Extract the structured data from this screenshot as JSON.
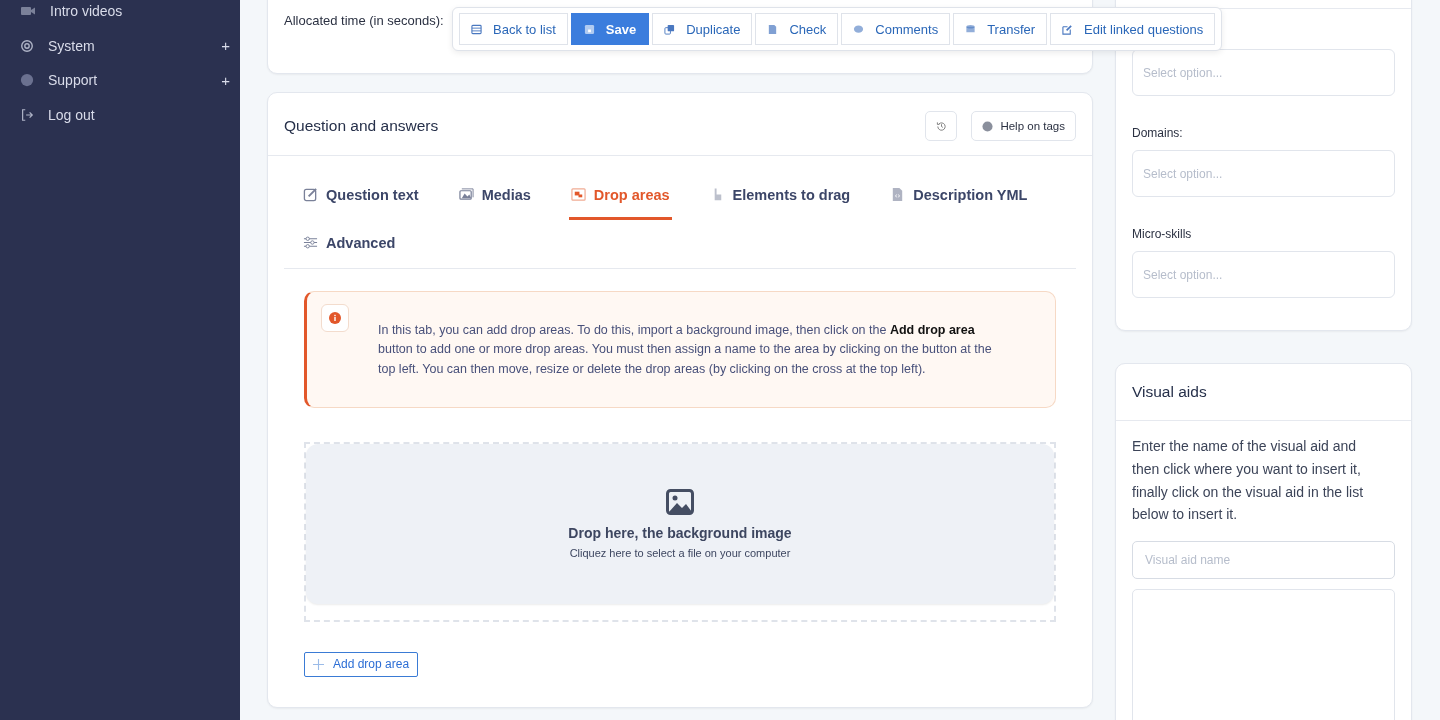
{
  "sidebar": {
    "items": [
      {
        "label": "Intro videos",
        "expandable": false
      },
      {
        "label": "System",
        "expandable": true
      },
      {
        "label": "Support",
        "expandable": true
      },
      {
        "label": "Log out",
        "expandable": false
      }
    ],
    "expand_symbol": "+"
  },
  "top_card": {
    "field_label": "Allocated time (in seconds):"
  },
  "toolbar": [
    {
      "label": "Back to list",
      "primary": false
    },
    {
      "label": "Save",
      "primary": true
    },
    {
      "label": "Duplicate",
      "primary": false
    },
    {
      "label": "Check",
      "primary": false
    },
    {
      "label": "Comments",
      "primary": false
    },
    {
      "label": "Transfer",
      "primary": false
    },
    {
      "label": "Edit linked questions",
      "primary": false
    }
  ],
  "question_card": {
    "title": "Question and answers",
    "help_button": "Help on tags",
    "tabs": [
      {
        "label": "Question text",
        "selected": false
      },
      {
        "label": "Medias",
        "selected": false
      },
      {
        "label": "Drop areas",
        "selected": true
      },
      {
        "label": "Elements to drag",
        "selected": false
      },
      {
        "label": "Description YML",
        "selected": false
      },
      {
        "label": "Advanced",
        "selected": false
      }
    ],
    "alert": "In this tab, you can add drop areas. To do this, import a background image, then click on the **Add drop area** button to add one or more drop areas. You must then assign a name to the area by clicking on the button at the top left. You can then move, resize or delete the drop areas (by clicking on the cross at the top left).",
    "dropzone": {
      "title": "Drop here, the background image",
      "subtitle": "Cliquez here to select a file on your computer"
    },
    "add_button": "Add drop area"
  },
  "filters_card": {
    "fields": [
      {
        "placeholder": "Select option..."
      },
      {
        "label": "Domains:",
        "placeholder": "Select option..."
      },
      {
        "label": "Micro-skills",
        "placeholder": "Select option..."
      }
    ]
  },
  "visual_aids": {
    "title": "Visual aids",
    "text": "Enter the name of the visual aid and then click where you want to insert it, finally click on the visual aid in the list below to insert it.",
    "input_placeholder": "Visual aid name"
  }
}
